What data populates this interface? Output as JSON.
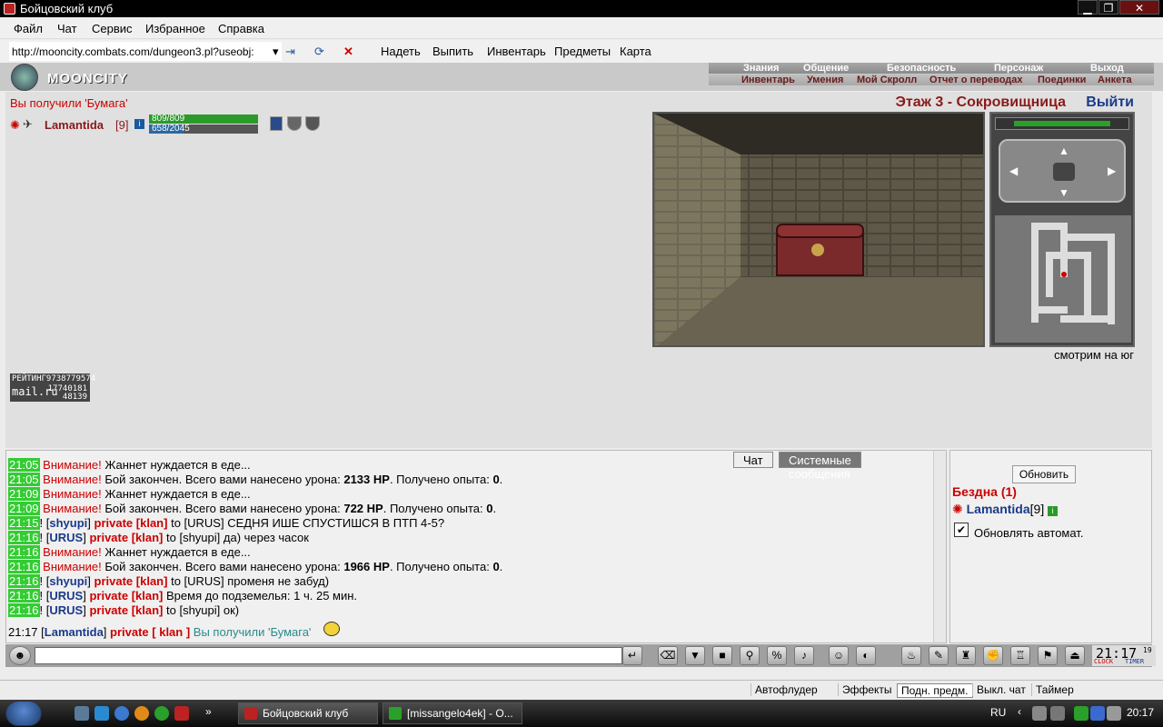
{
  "window": {
    "title": "Бойцовский клуб",
    "minimize": "▁",
    "maximize": "❐",
    "close": "✕"
  },
  "menu": [
    "Файл",
    "Чат",
    "Сервис",
    "Избранное",
    "Справка"
  ],
  "address": {
    "url": "http://mooncity.combats.com/dungeon3.pl?useobj:"
  },
  "toolbar": [
    "Надеть",
    "Выпить",
    "Инвентарь",
    "Предметы",
    "Карта"
  ],
  "logo": "MOONCITY",
  "topnav": {
    "row1": [
      "Знания",
      "Общение",
      "Безопасность",
      "Персонаж",
      "Выход"
    ],
    "row2": [
      "Инвентарь",
      "Умения",
      "Мой Скролл",
      "Отчет о переводах",
      "Поединки",
      "Анкета"
    ]
  },
  "game": {
    "notice": "Вы получили 'Бумага'",
    "player_name": "Lamantida",
    "player_level": "[9]",
    "hp": "809/809",
    "mana": "658/2045",
    "hp_fraction": 1.0,
    "mana_fraction": 0.32,
    "floor": "Этаж 3 - Сокровищница",
    "exit": "Выйти",
    "direction": "смотрим на юг",
    "counter_line1": "РЕЙТИНГ9738779574",
    "counter_line2": "mail.ru",
    "counter_num1": "17740181",
    "counter_num2": "48139"
  },
  "chat": {
    "tabs": [
      "Чат",
      "Системные сообщения"
    ],
    "lines": [
      {
        "time": "21:05",
        "type": "warn",
        "head": "Внимание!",
        "text": " Жаннет нуждается в еде..."
      },
      {
        "time": "21:05",
        "type": "warn",
        "head": "Внимание!",
        "text": " Бой закончен. Всего вами нанесено урона: ",
        "b1": "2133 HP",
        "t2": ". Получено опыта: ",
        "b2": "0",
        "t3": "."
      },
      {
        "time": "21:09",
        "type": "warn",
        "head": "Внимание!",
        "text": " Жаннет нуждается в еде..."
      },
      {
        "time": "21:09",
        "type": "warn",
        "head": "Внимание!",
        "text": " Бой закончен. Всего вами нанесено урона: ",
        "b1": "722 HP",
        "t2": ". Получено опыта: ",
        "b2": "0",
        "t3": "."
      },
      {
        "time": "21:15",
        "type": "priv",
        "nick": "shyupi",
        "to": "to [URUS] СЕДНЯ ИШЕ СПУСТИШСЯ В ПТП 4-5?"
      },
      {
        "time": "21:16",
        "type": "priv",
        "nick": "URUS",
        "to": "to [shyupi] да) через часок"
      },
      {
        "time": "21:16",
        "type": "warn",
        "head": "Внимание!",
        "text": " Жаннет нуждается в еде..."
      },
      {
        "time": "21:16",
        "type": "warn",
        "head": "Внимание!",
        "text": " Бой закончен. Всего вами нанесено урона: ",
        "b1": "1966 HP",
        "t2": ". Получено опыта: ",
        "b2": "0",
        "t3": "."
      },
      {
        "time": "21:16",
        "type": "priv",
        "nick": "shyupi",
        "to": "to [URUS] променя не забуд)"
      },
      {
        "time": "21:16",
        "type": "priv",
        "nick": "URUS",
        "to": "Время до подземелья: 1 ч. 25 мин."
      },
      {
        "time": "21:16",
        "type": "priv",
        "nick": "URUS",
        "to": "to [shyupi] ок)"
      }
    ],
    "private_label": "private [klan]",
    "last": {
      "time": "21:17",
      "nick": "Lamantida",
      "priv": "private [ klan ]",
      "text": "Вы получили 'Бумага'"
    }
  },
  "side": {
    "refresh": "Обновить",
    "location": "Бездна (1)",
    "player": "Lamantida",
    "level": "[9]",
    "auto_label": "Обновлять автомат.",
    "auto_checked": "✔"
  },
  "clock": {
    "time": "21:17",
    "sec": "19",
    "label1": "CLOCK",
    "label2": "TIMER"
  },
  "statusbar": [
    "Автофлудер",
    "Эффекты",
    "Подн. предм.",
    "Выкл. чат",
    "Таймер"
  ],
  "taskbar": {
    "tasks": [
      "Бойцовский клуб",
      "[missangelo4ek] - О..."
    ],
    "lang": "RU",
    "time": "20:17"
  },
  "colors": {
    "accent": "#8b1a1a",
    "hp": "#2a9a2a",
    "mana": "#2a6aa0"
  }
}
